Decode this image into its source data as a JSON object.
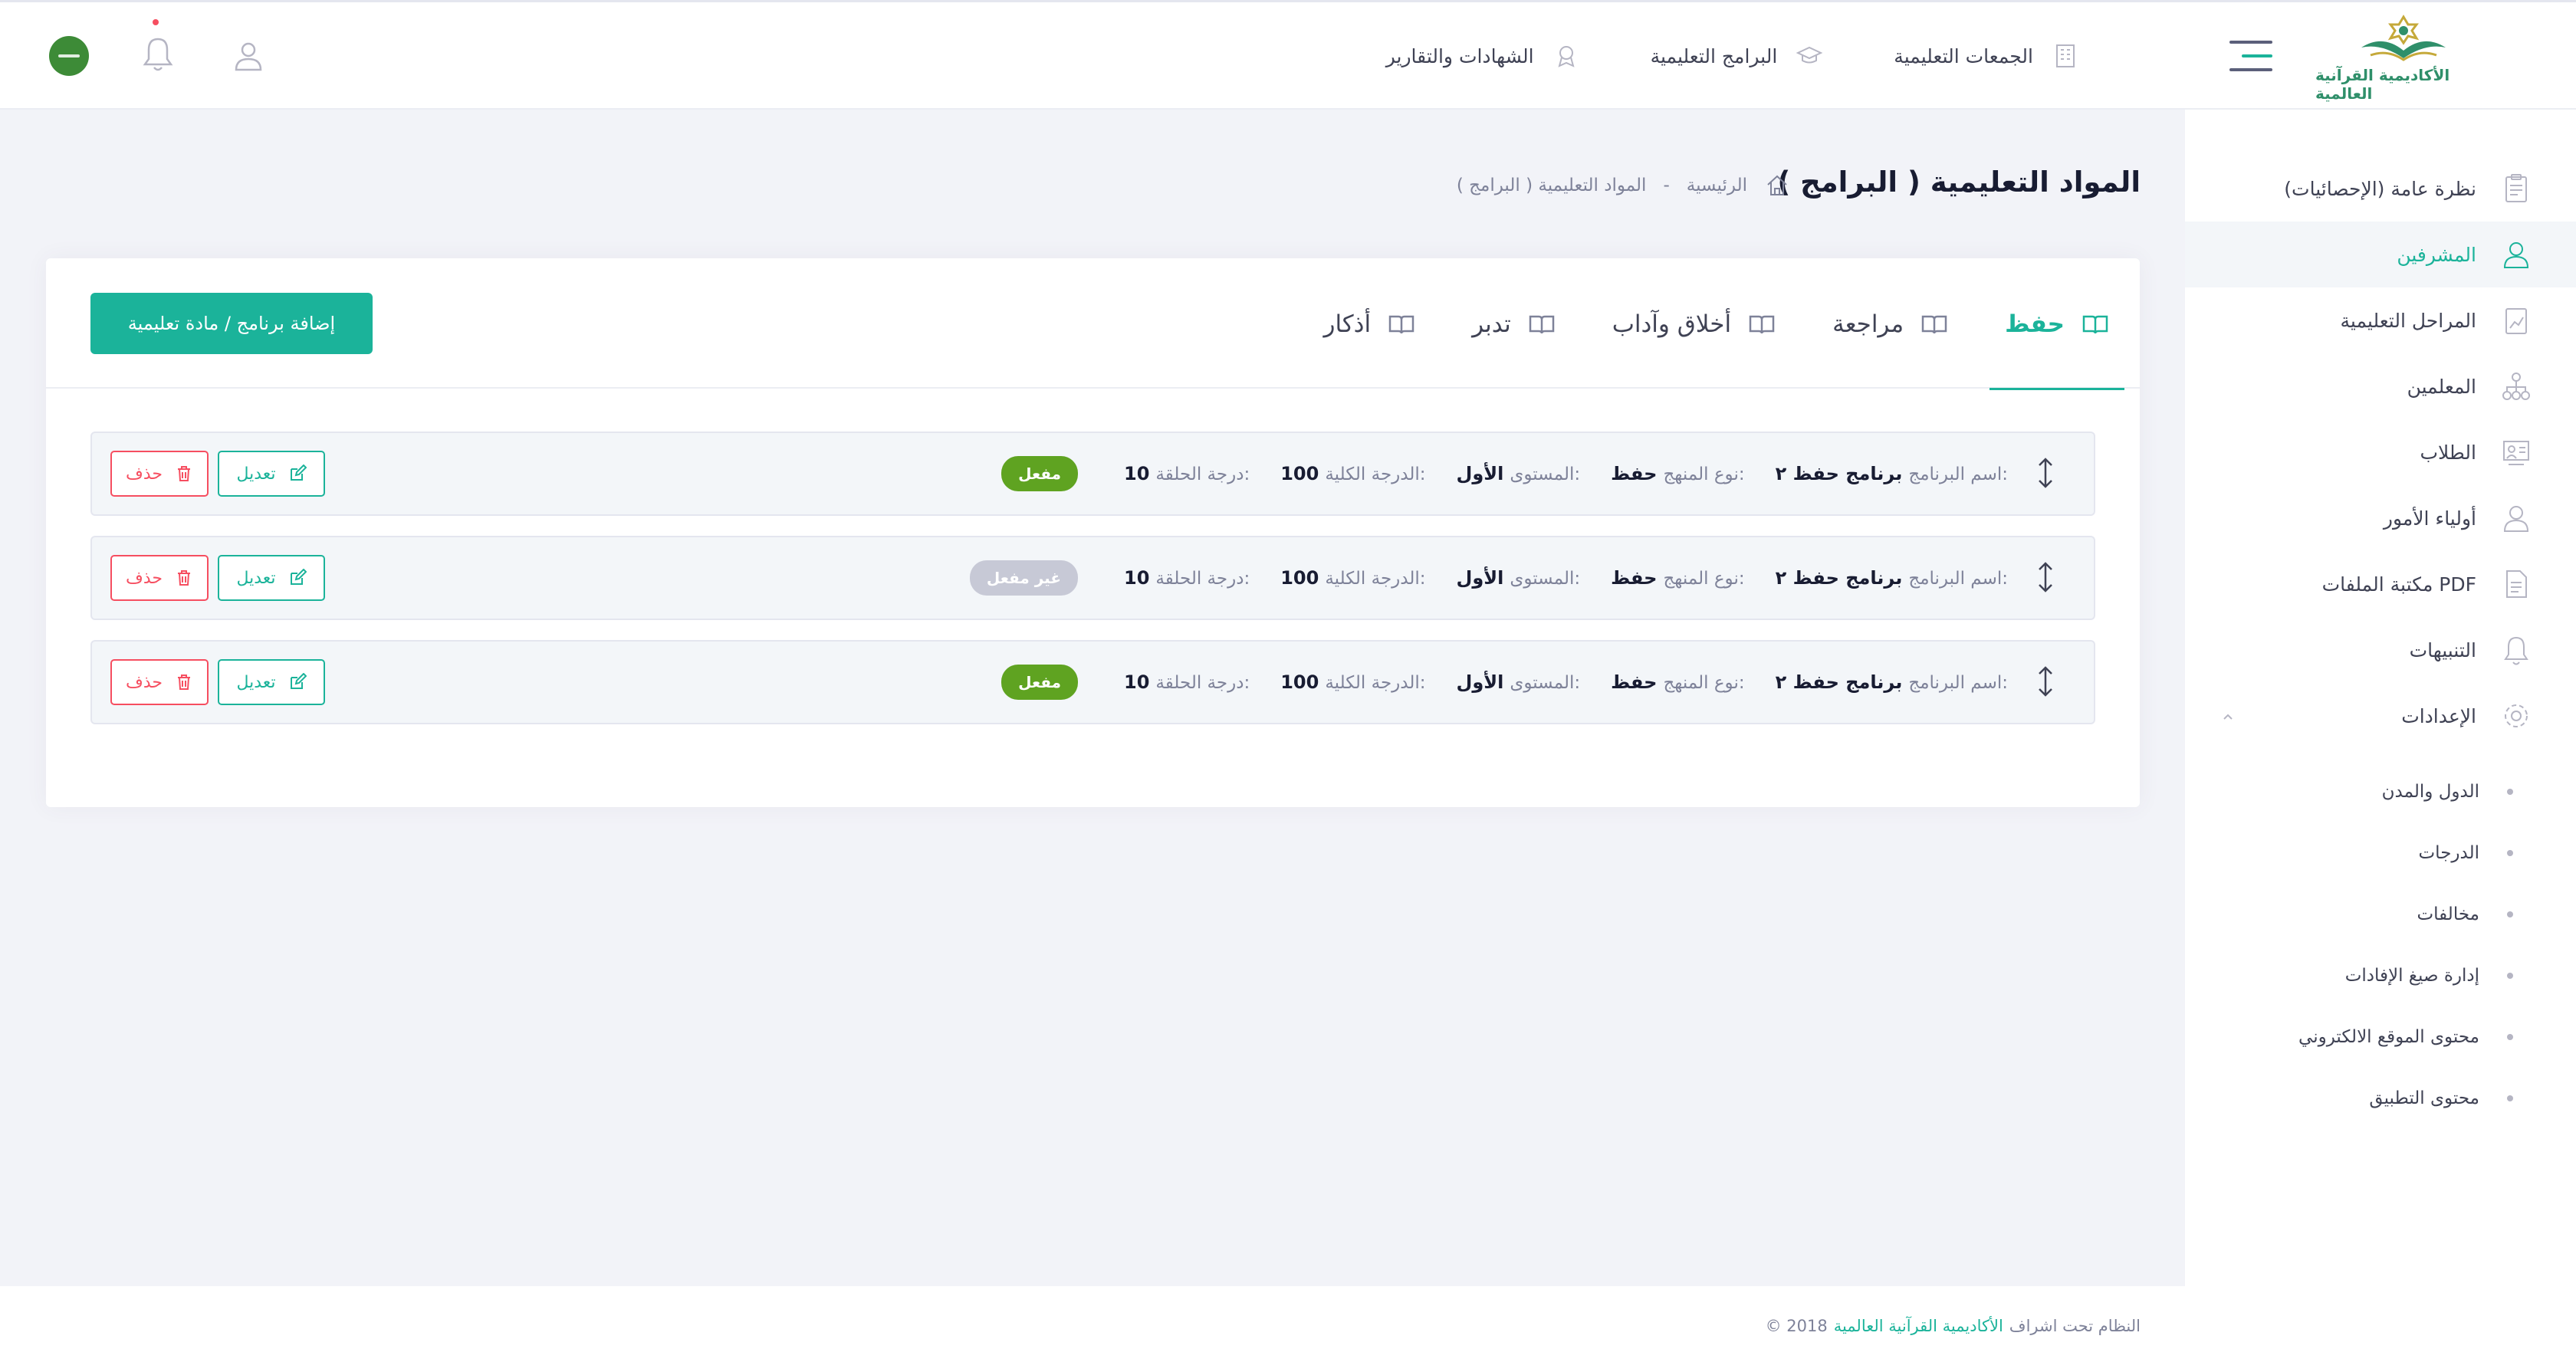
{
  "header": {
    "brand_name": "الأكاديمية القرآنية العالمية",
    "nav": [
      {
        "label": "الجمعات التعليمية",
        "icon": "building-icon"
      },
      {
        "label": "البرامج التعليمية",
        "icon": "graduation-cap-icon"
      },
      {
        "label": "الشهادات والتقارير",
        "icon": "award-icon"
      }
    ],
    "icons": [
      "menu-icon",
      "user-icon",
      "bell-icon",
      "language-flag-icon"
    ],
    "colors": {
      "accent": "#1bb39a",
      "notification_dot": "#f64e60"
    }
  },
  "sidebar": {
    "items": [
      {
        "label": "نظرة عامة (الإحصائيات)",
        "icon": "clipboard-icon",
        "active": false
      },
      {
        "label": "المشرفين",
        "icon": "user-icon",
        "active": true
      },
      {
        "label": "المراحل التعليمية",
        "icon": "chart-clipboard-icon",
        "active": false
      },
      {
        "label": "المعلمين",
        "icon": "hierarchy-icon",
        "active": false
      },
      {
        "label": "الطلاب",
        "icon": "students-icon",
        "active": false
      },
      {
        "label": "أولياء الأمور",
        "icon": "user-icon",
        "active": false
      },
      {
        "label": "مكتبة الملفات PDF",
        "icon": "document-icon",
        "active": false
      },
      {
        "label": "التنبيهات",
        "icon": "bell-icon",
        "active": false
      },
      {
        "label": "الإعدادات",
        "icon": "gear-icon",
        "active": false,
        "expanded": true
      }
    ],
    "settings_subitems": [
      {
        "label": "الدول والمدن"
      },
      {
        "label": "الدرجات"
      },
      {
        "label": "مخالفات"
      },
      {
        "label": "إدارة صيغ الإفادات"
      },
      {
        "label": "محتوى الموقع الالكتروني"
      },
      {
        "label": "محتوى التطبيق"
      }
    ]
  },
  "subheader": {
    "title": "( البرامج ) المواد التعليمية",
    "breadcrumb": {
      "home": "الرئيسية",
      "separator": "-",
      "current": "( البرامج ) المواد التعليمية"
    }
  },
  "main": {
    "tabs": [
      {
        "label": "حفظ",
        "active": true
      },
      {
        "label": "مراجعة",
        "active": false
      },
      {
        "label": "أخلاق وآداب",
        "active": false
      },
      {
        "label": "تدبر",
        "active": false
      },
      {
        "label": "أذكار",
        "active": false
      }
    ],
    "add_button_label": "إضافة برنامج / مادة تعليمية",
    "field_labels": {
      "program_name": "اسم البرنامج:",
      "curriculum_type": "نوع المنهج:",
      "level": "المستوى:",
      "total_grade": "الدرجة الكلية:",
      "circle_grade": "درجة الحلقة:"
    },
    "edit_label": "تعديل",
    "delete_label": "حذف",
    "rows": [
      {
        "program_name": "برنامج حفظ ٢",
        "curriculum_type": "حفظ",
        "level": "الأول",
        "total_grade": "100",
        "circle_grade": "10",
        "status": "مفعل",
        "status_active": true
      },
      {
        "program_name": "برنامج حفظ ٢",
        "curriculum_type": "حفظ",
        "level": "الأول",
        "total_grade": "100",
        "circle_grade": "10",
        "status": "غير مفعل",
        "status_active": false
      },
      {
        "program_name": "برنامج حفظ ٢",
        "curriculum_type": "حفظ",
        "level": "الأول",
        "total_grade": "100",
        "circle_grade": "10",
        "status": "مفعل",
        "status_active": true
      }
    ]
  },
  "footer": {
    "prefix": "النظام تحت اشراف",
    "academy": "الأكاديمية القرآنية العالمية",
    "suffix": "© 2018"
  }
}
